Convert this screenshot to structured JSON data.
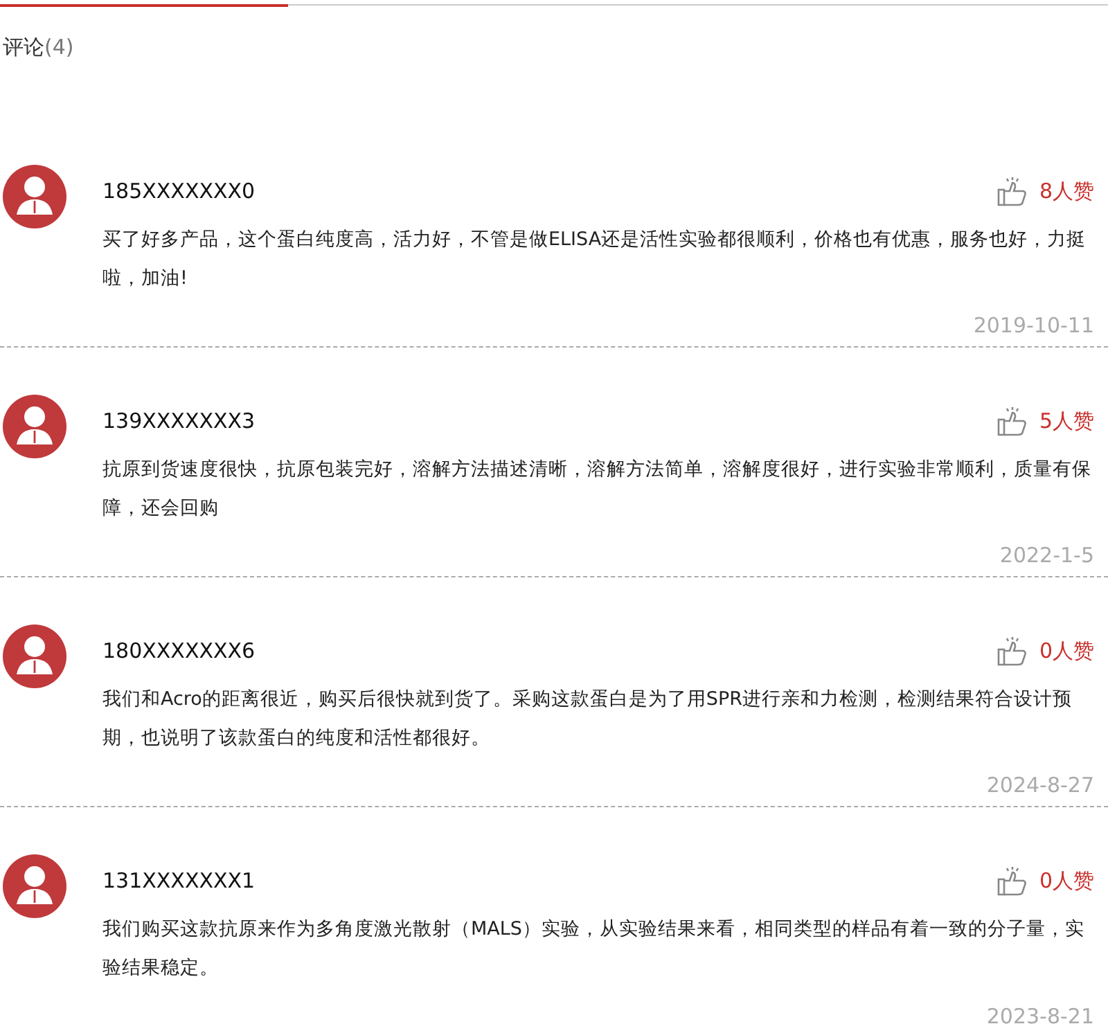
{
  "section": {
    "title": "评论",
    "count": "(4)"
  },
  "comments": [
    {
      "user": "185XXXXXXX0",
      "likes": "8人赞",
      "text": "买了好多产品，这个蛋白纯度高，活力好，不管是做ELISA还是活性实验都很顺利，价格也有优惠，服务也好，力挺啦，加油!",
      "date": "2019-10-11"
    },
    {
      "user": "139XXXXXXX3",
      "likes": "5人赞",
      "text": "抗原到货速度很快，抗原包装完好，溶解方法描述清晰，溶解方法简单，溶解度很好，进行实验非常顺利，质量有保障，还会回购",
      "date": "2022-1-5"
    },
    {
      "user": "180XXXXXXX6",
      "likes": "0人赞",
      "text": "我们和Acro的距离很近，购买后很快就到货了。采购这款蛋白是为了用SPR进行亲和力检测，检测结果符合设计预期，也说明了该款蛋白的纯度和活性都很好。",
      "date": "2024-8-27"
    },
    {
      "user": "131XXXXXXX1",
      "likes": "0人赞",
      "text": "我们购买这款抗原来作为多角度激光散射（MALS）实验，从实验结果来看，相同类型的样品有着一致的分子量，实验结果稳定。",
      "date": "2023-8-21"
    }
  ]
}
